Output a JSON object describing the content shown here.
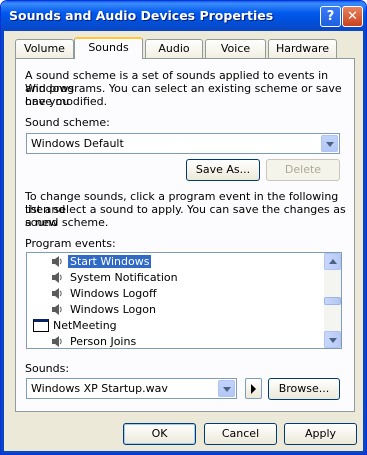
{
  "window": {
    "title": "Sounds and Audio Devices Properties",
    "help_glyph": "?",
    "close_glyph": "✕"
  },
  "tabs": [
    "Volume",
    "Sounds",
    "Audio",
    "Voice",
    "Hardware"
  ],
  "active_tab": "Sounds",
  "sounds_tab": {
    "scheme_description": [
      "A sound scheme is a set of sounds applied to events in Windows",
      "and programs. You can select an existing scheme or save one you",
      "have modified."
    ],
    "scheme_label": "Sound scheme:",
    "scheme_value": "Windows Default",
    "save_as_label": "Save As...",
    "delete_label": "Delete",
    "events_description": [
      "To change sounds, click a program event in the following list and",
      "then select a sound to apply. You can save the changes as a new",
      "sound scheme."
    ],
    "events_label": "Program events:",
    "events": [
      {
        "label": "Start Windows",
        "type": "sound-event",
        "selected": true
      },
      {
        "label": "System Notification",
        "type": "sound-event",
        "selected": false
      },
      {
        "label": "Windows Logoff",
        "type": "sound-event",
        "selected": false
      },
      {
        "label": "Windows Logon",
        "type": "sound-event",
        "selected": false
      },
      {
        "label": "NetMeeting",
        "type": "application-group",
        "selected": false
      },
      {
        "label": "Person Joins",
        "type": "sound-event",
        "selected": false
      }
    ],
    "sounds_label": "Sounds:",
    "sound_value": "Windows XP Startup.wav",
    "browse_label": "Browse..."
  },
  "footer": {
    "ok_label": "OK",
    "cancel_label": "Cancel",
    "apply_label": "Apply"
  }
}
